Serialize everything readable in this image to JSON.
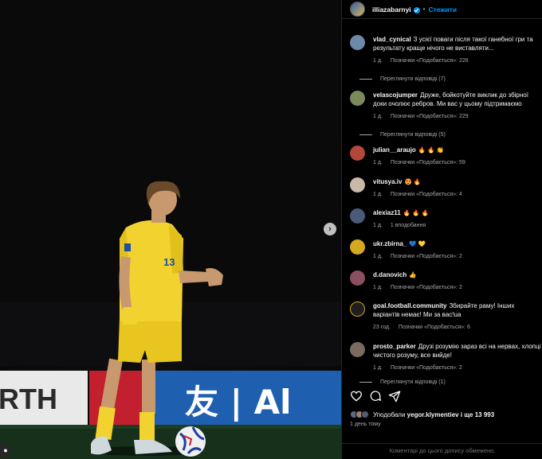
{
  "photo": {
    "jersey_number": "13",
    "banner_left_text": "RTH",
    "banner_right_text": "友 | Al"
  },
  "header": {
    "username": "illiazabarnyi",
    "separator": "•",
    "follow_label": "Стежити"
  },
  "comments": [
    {
      "user": "vlad_cynical",
      "text": "З усієї поваги після такої ганебної гри та результату краще нічого не виставляти...",
      "age": "1 д.",
      "likes": "Позначки «Подобається»: 226",
      "replies": "Переглянути відповіді (7)",
      "avatar_color": "#6d88a8"
    },
    {
      "user": "velascojumper",
      "text": "Друже, бойкотуйте виклик до збірної доки очолює ребров. Ми вас у цьому підтримаємо",
      "age": "1 д.",
      "likes": "Позначки «Подобається»: 229",
      "replies": "Переглянути відповіді (5)",
      "avatar_color": "#7a8a5a"
    },
    {
      "user": "julian__araujo",
      "text": "🔥 🔥 👏",
      "age": "1 д.",
      "likes": "Позначки «Подобається»: 59",
      "replies": "",
      "avatar_color": "#b2473a"
    },
    {
      "user": "vitusya.iv",
      "text": "😍 🔥",
      "age": "1 д.",
      "likes": "Позначки «Подобається»: 4",
      "replies": "",
      "avatar_color": "#c9b9a8"
    },
    {
      "user": "alexiaz11",
      "text": "🔥 🔥 🔥",
      "age": "1 д.",
      "likes": "1 вподобання",
      "replies": "",
      "avatar_color": "#4a5a78"
    },
    {
      "user": "ukr.zbirna_",
      "text": "💙 💛",
      "age": "1 д.",
      "likes": "Позначки «Подобається»: 2",
      "replies": "",
      "avatar_color": "#d4a91e"
    },
    {
      "user": "d.danovich",
      "text": "👍",
      "age": "1 д.",
      "likes": "Позначки «Подобається»: 2",
      "replies": "",
      "avatar_color": "#8a5060"
    },
    {
      "user": "goal.football.community",
      "text": "Збирайте раму! Інших варіантів немає! Ми за вас!ua",
      "age": "23 год.",
      "likes": "Позначки «Подобається»: 6",
      "replies": "",
      "avatar_color": "#1e1e1e"
    },
    {
      "user": "prosto_parker",
      "text": "Друзі розумію зараз всі на нервах, хлопці чистого розуму, все вийде!",
      "age": "1 д.",
      "likes": "Позначки «Подобається»: 2",
      "replies": "Переглянути відповіді (1)",
      "avatar_color": "#7a6a60"
    }
  ],
  "footer": {
    "liked_by_prefix": "Уподобали",
    "liked_by_user": "yegor.klymentiev",
    "liked_by_suffix": "і ще 13 993",
    "date": "1 день тому",
    "comments_limited": "Коментарі до цього допису обмежено."
  },
  "colors": {
    "accent": "#0095f6",
    "jersey": "#f2d22e",
    "banner_blue": "#1f5fb0"
  }
}
